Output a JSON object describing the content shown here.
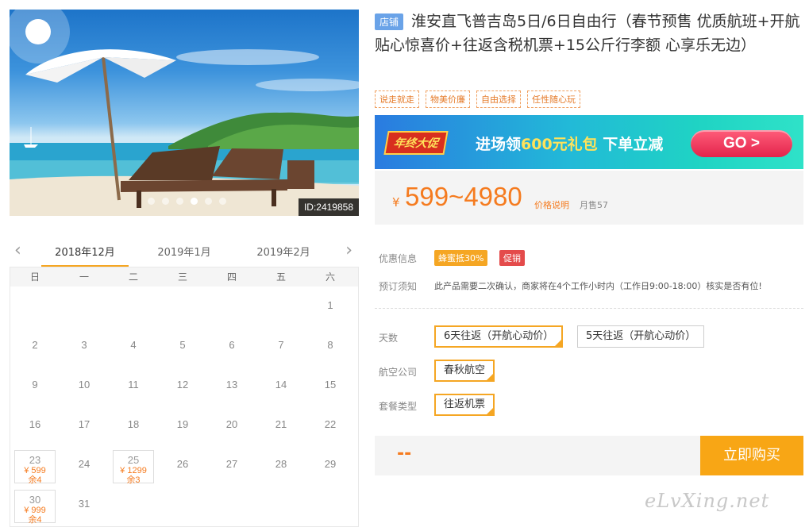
{
  "hero": {
    "id_label": "ID:2419858",
    "slide_count": 6,
    "active_slide": 3
  },
  "calendar": {
    "months": [
      "2018年12月",
      "2019年1月",
      "2019年2月"
    ],
    "active_month": 0,
    "weekdays": [
      "日",
      "一",
      "二",
      "三",
      "四",
      "五",
      "六"
    ],
    "cells": [
      {
        "day": ""
      },
      {
        "day": ""
      },
      {
        "day": ""
      },
      {
        "day": ""
      },
      {
        "day": ""
      },
      {
        "day": ""
      },
      {
        "day": "1"
      },
      {
        "day": "2"
      },
      {
        "day": "3"
      },
      {
        "day": "4"
      },
      {
        "day": "5"
      },
      {
        "day": "6"
      },
      {
        "day": "7"
      },
      {
        "day": "8"
      },
      {
        "day": "9"
      },
      {
        "day": "10"
      },
      {
        "day": "11"
      },
      {
        "day": "12"
      },
      {
        "day": "13"
      },
      {
        "day": "14"
      },
      {
        "day": "15"
      },
      {
        "day": "16"
      },
      {
        "day": "17"
      },
      {
        "day": "18"
      },
      {
        "day": "19"
      },
      {
        "day": "20"
      },
      {
        "day": "21"
      },
      {
        "day": "22"
      },
      {
        "day": "23",
        "price": "¥ 599",
        "stock": "余4"
      },
      {
        "day": "24"
      },
      {
        "day": "25",
        "price": "¥ 1299",
        "stock": "余3"
      },
      {
        "day": "26"
      },
      {
        "day": "27"
      },
      {
        "day": "28"
      },
      {
        "day": "29"
      },
      {
        "day": "30",
        "price": "¥ 999",
        "stock": "余4"
      },
      {
        "day": "31"
      }
    ]
  },
  "product": {
    "shop_badge": "店铺",
    "title": "淮安直飞普吉岛5日/6日自由行（春节预售 优质航班+开航贴心惊喜价+往返含税机票+15公斤行李额 心享乐无边）",
    "tags": [
      "说走就走",
      "物美价廉",
      "自由选择",
      "任性随心玩"
    ]
  },
  "banner": {
    "tag": "年终大促",
    "text_a": "进场领",
    "text_hl": "600元礼包",
    "text_b": " 下单立减",
    "go": "GO >"
  },
  "price": {
    "currency": "¥",
    "value": "599~4980",
    "link": "价格说明",
    "sold": "月售57"
  },
  "info": {
    "promo_label": "优惠信息",
    "promo_badges": [
      "蜂蜜抵30%",
      "促销"
    ],
    "notice_label": "预订须知",
    "notice_text": "此产品需要二次确认，商家将在4个工作小时内（工作日9:00-18:00）核实是否有位!"
  },
  "options": {
    "days_label": "天数",
    "days": [
      "6天往返（开航心动价）",
      "5天往返（开航心动价）"
    ],
    "days_selected": 0,
    "airline_label": "航空公司",
    "airline": "春秋航空",
    "package_label": "套餐类型",
    "package": "往返机票"
  },
  "buy": {
    "total": "--",
    "button": "立即购买"
  },
  "watermark": "eLvXing.net",
  "colors": {
    "accent": "#f8a615",
    "price": "#f57b1f",
    "badge_blue": "#6aa3e8",
    "promo_red": "#e44b4b"
  }
}
